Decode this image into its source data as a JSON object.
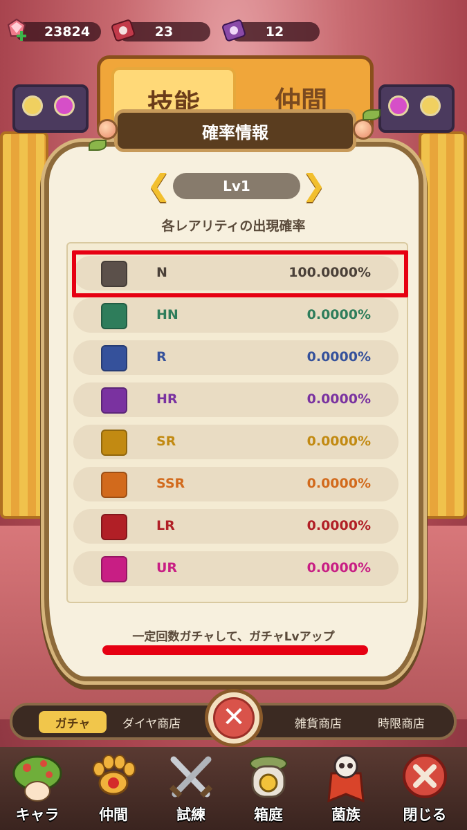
{
  "currencies": [
    {
      "icon": "gem-plus-icon",
      "value": "23824"
    },
    {
      "icon": "ticket-icon",
      "value": "23"
    },
    {
      "icon": "purple-ticket-icon",
      "value": "12"
    }
  ],
  "background_tabs": [
    "技能",
    "仲間"
  ],
  "dialog": {
    "title": "確率情報",
    "level": "Lv1",
    "subtitle": "各レアリティの出現確率",
    "footnote": "一定回数ガチャして、ガチャLvアップ",
    "rates": [
      {
        "rarity": "N",
        "percent": "100.0000%",
        "color": "#5b504a"
      },
      {
        "rarity": "HN",
        "percent": "0.0000%",
        "color": "#2e7d5b"
      },
      {
        "rarity": "R",
        "percent": "0.0000%",
        "color": "#35519b"
      },
      {
        "rarity": "HR",
        "percent": "0.0000%",
        "color": "#7a32a0"
      },
      {
        "rarity": "SR",
        "percent": "0.0000%",
        "color": "#c28a12"
      },
      {
        "rarity": "SSR",
        "percent": "0.0000%",
        "color": "#d26a1c"
      },
      {
        "rarity": "LR",
        "percent": "0.0000%",
        "color": "#b11f26"
      },
      {
        "rarity": "UR",
        "percent": "0.0000%",
        "color": "#c81e84"
      }
    ]
  },
  "shop_tabs": [
    "ガチャ",
    "ダイヤ商店",
    "雑貨商店",
    "時限商店"
  ],
  "bottom_nav": [
    {
      "label": "キャラ",
      "icon": "mushroom-character-icon"
    },
    {
      "label": "仲間",
      "icon": "paw-icon"
    },
    {
      "label": "試練",
      "icon": "crossed-swords-icon"
    },
    {
      "label": "箱庭",
      "icon": "garden-shrine-icon"
    },
    {
      "label": "菌族",
      "icon": "skull-banner-icon"
    },
    {
      "label": "閉じる",
      "icon": "close-icon"
    }
  ],
  "colors": {
    "highlight": "#e60012",
    "level_arrow": "#f2bf2e",
    "dialog_background": "#f7f0de"
  }
}
